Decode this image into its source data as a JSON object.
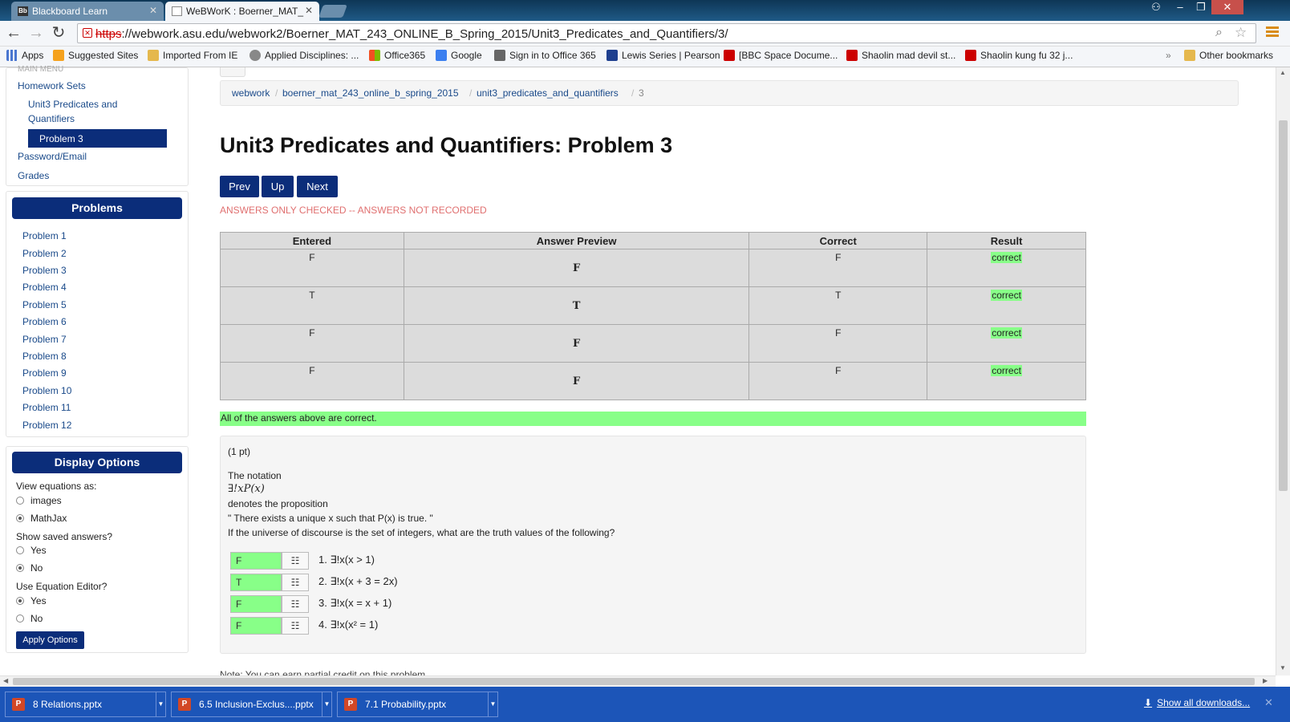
{
  "browser": {
    "tabs": [
      {
        "icon": "Bb",
        "label": "Blackboard Learn"
      },
      {
        "icon": "",
        "label": "WeBWorK : Boerner_MAT_"
      }
    ],
    "url_scheme": "https",
    "url_rest": "://webwork.asu.edu/webwork2/Boerner_MAT_243_ONLINE_B_Spring_2015/Unit3_Predicates_and_Quantifiers/3/",
    "bookmarks": [
      "Apps",
      "Suggested Sites",
      "Imported From IE",
      "Applied Disciplines: ...",
      "Office365",
      "Google",
      "Sign in to Office 365",
      "Lewis Series | Pearson",
      "[BBC Space Docume...",
      "Shaolin mad devil st...",
      "Shaolin kung fu 32 j..."
    ],
    "overflow": "»",
    "other_bookmarks": "Other bookmarks"
  },
  "sidebar": {
    "main_menu_cut": "MAIN MENU",
    "homework_sets": "Homework Sets",
    "set_name_line1": "Unit3 Predicates and",
    "set_name_line2": "Quantifiers",
    "current_problem": "Problem 3",
    "password_email": "Password/Email",
    "grades": "Grades",
    "problems_header": "Problems",
    "problems": [
      "Problem 1",
      "Problem 2",
      "Problem 3",
      "Problem 4",
      "Problem 5",
      "Problem 6",
      "Problem 7",
      "Problem 8",
      "Problem 9",
      "Problem 10",
      "Problem 11",
      "Problem 12"
    ],
    "display_header": "Display Options",
    "view_eq_label": "View equations as:",
    "view_eq_options": [
      "images",
      "MathJax"
    ],
    "view_eq_selected": "MathJax",
    "saved_label": "Show saved answers?",
    "saved_options": [
      "Yes",
      "No"
    ],
    "saved_selected": "No",
    "editor_label": "Use Equation Editor?",
    "editor_options": [
      "Yes",
      "No"
    ],
    "editor_selected": "Yes",
    "apply_button": "Apply Options"
  },
  "main": {
    "breadcrumbs": [
      "webwork",
      "boerner_mat_243_online_b_spring_2015",
      "unit3_predicates_and_quantifiers",
      "3"
    ],
    "title": "Unit3 Predicates and Quantifiers: Problem 3",
    "nav": [
      "Prev",
      "Up",
      "Next"
    ],
    "warning": "ANSWERS ONLY CHECKED -- ANSWERS NOT RECORDED",
    "table_headers": [
      "Entered",
      "Answer Preview",
      "Correct",
      "Result"
    ],
    "rows": [
      {
        "entered": "F",
        "preview": "F",
        "correct": "F",
        "result": "correct"
      },
      {
        "entered": "T",
        "preview": "T",
        "correct": "T",
        "result": "correct"
      },
      {
        "entered": "F",
        "preview": "F",
        "correct": "F",
        "result": "correct"
      },
      {
        "entered": "F",
        "preview": "F",
        "correct": "F",
        "result": "correct"
      }
    ],
    "all_correct": "All of the answers above are correct.",
    "problem": {
      "points": "(1 pt)",
      "line1": "The notation",
      "notation": "∃!xP(x)",
      "line2": "denotes the proposition",
      "line3": "\" There exists a unique x such that P(x) is true. \"",
      "line4": "If the universe of discourse is the set of integers, what are the truth values of the following?",
      "answers": [
        {
          "value": "F",
          "label": "1. ∃!x(x > 1)"
        },
        {
          "value": "T",
          "label": "2. ∃!x(x + 3 = 2x)"
        },
        {
          "value": "F",
          "label": "3. ∃!x(x = x + 1)"
        },
        {
          "value": "F",
          "label": "4. ∃!x(x² = 1)"
        }
      ],
      "editor_icon": "grid-icon"
    },
    "cut_note": "Note: You can earn partial credit on this problem."
  },
  "downloads": {
    "items": [
      "8 Relations.pptx",
      "6.5 Inclusion-Exclus....pptx",
      "7.1 Probability.pptx"
    ],
    "show_all": "Show all downloads..."
  }
}
